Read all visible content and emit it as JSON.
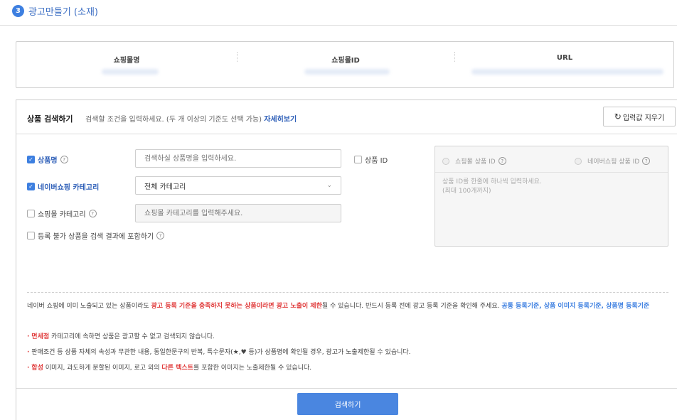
{
  "step": {
    "number": "3",
    "title": "광고만들기 (소재)"
  },
  "shop_info": {
    "columns": [
      "쇼핑몰명",
      "쇼핑몰ID",
      "URL"
    ]
  },
  "search": {
    "title": "상품 검색하기",
    "description": "검색할 조건을 입력하세요. (두 개 이상의 기준도 선택 가능)",
    "detail_link": "자세히보기",
    "reset_label": "입력값 지우기",
    "product_name_label": "상품명",
    "product_name_placeholder": "검색하실 상품명을 입력하세요.",
    "category_label": "네이버쇼핑 카테고리",
    "category_value": "전체 카테고리",
    "mall_category_label": "쇼핑몰 카테고리",
    "mall_category_placeholder": "쇼핑몰 카테고리를 입력해주세요.",
    "include_unregisterable_label": "등록 불가 상품을 검색 결과에 포함하기",
    "product_id_label": "상품 ID",
    "mall_product_id_label": "쇼핑몰 상품 ID",
    "naver_product_id_label": "네이버쇼핑 상품 ID",
    "product_id_placeholder_1": "상품 ID를 한줄에 하나씩 입력하세요.",
    "product_id_placeholder_2": "(최대 100개까지)",
    "search_button": "검색하기"
  },
  "notice": {
    "line1_a": "네이버 쇼핑에 이미 노출되고 있는 상품이라도 ",
    "line1_red": "광고 등록 기준을 충족하지 못하는 상품이라면 광고 노출이 제한",
    "line1_b": "될 수 있습니다. 반드시 등록 전에 광고 등록 기준을 확인해 주세요. ",
    "link_common": "공통 등록기준",
    "link_image": "상품 이미지 등록기준",
    "link_name": "상품명 등록기준",
    "sep": ", ",
    "bullet1_red": "면세점",
    "bullet1_rest": " 카테고리에 속하면 상품은 광고할 수 없고 검색되지 않습니다.",
    "bullet2": "판매조건 등 상품 자체의 속성과 무관한 내용, 동일한문구의 반복, 특수문자(★,♥ 등)가 상품명에 확인될 경우, 광고가 노출제한될 수 있습니다.",
    "bullet3_red1": "합성",
    "bullet3_mid": " 이미지, 과도하게 분할된 이미지, 로고 외의 ",
    "bullet3_red2": "다른 텍스트",
    "bullet3_rest": "를 포함한 이미지는 노출제한될 수 있습니다.",
    "bullet_dot": "·"
  }
}
